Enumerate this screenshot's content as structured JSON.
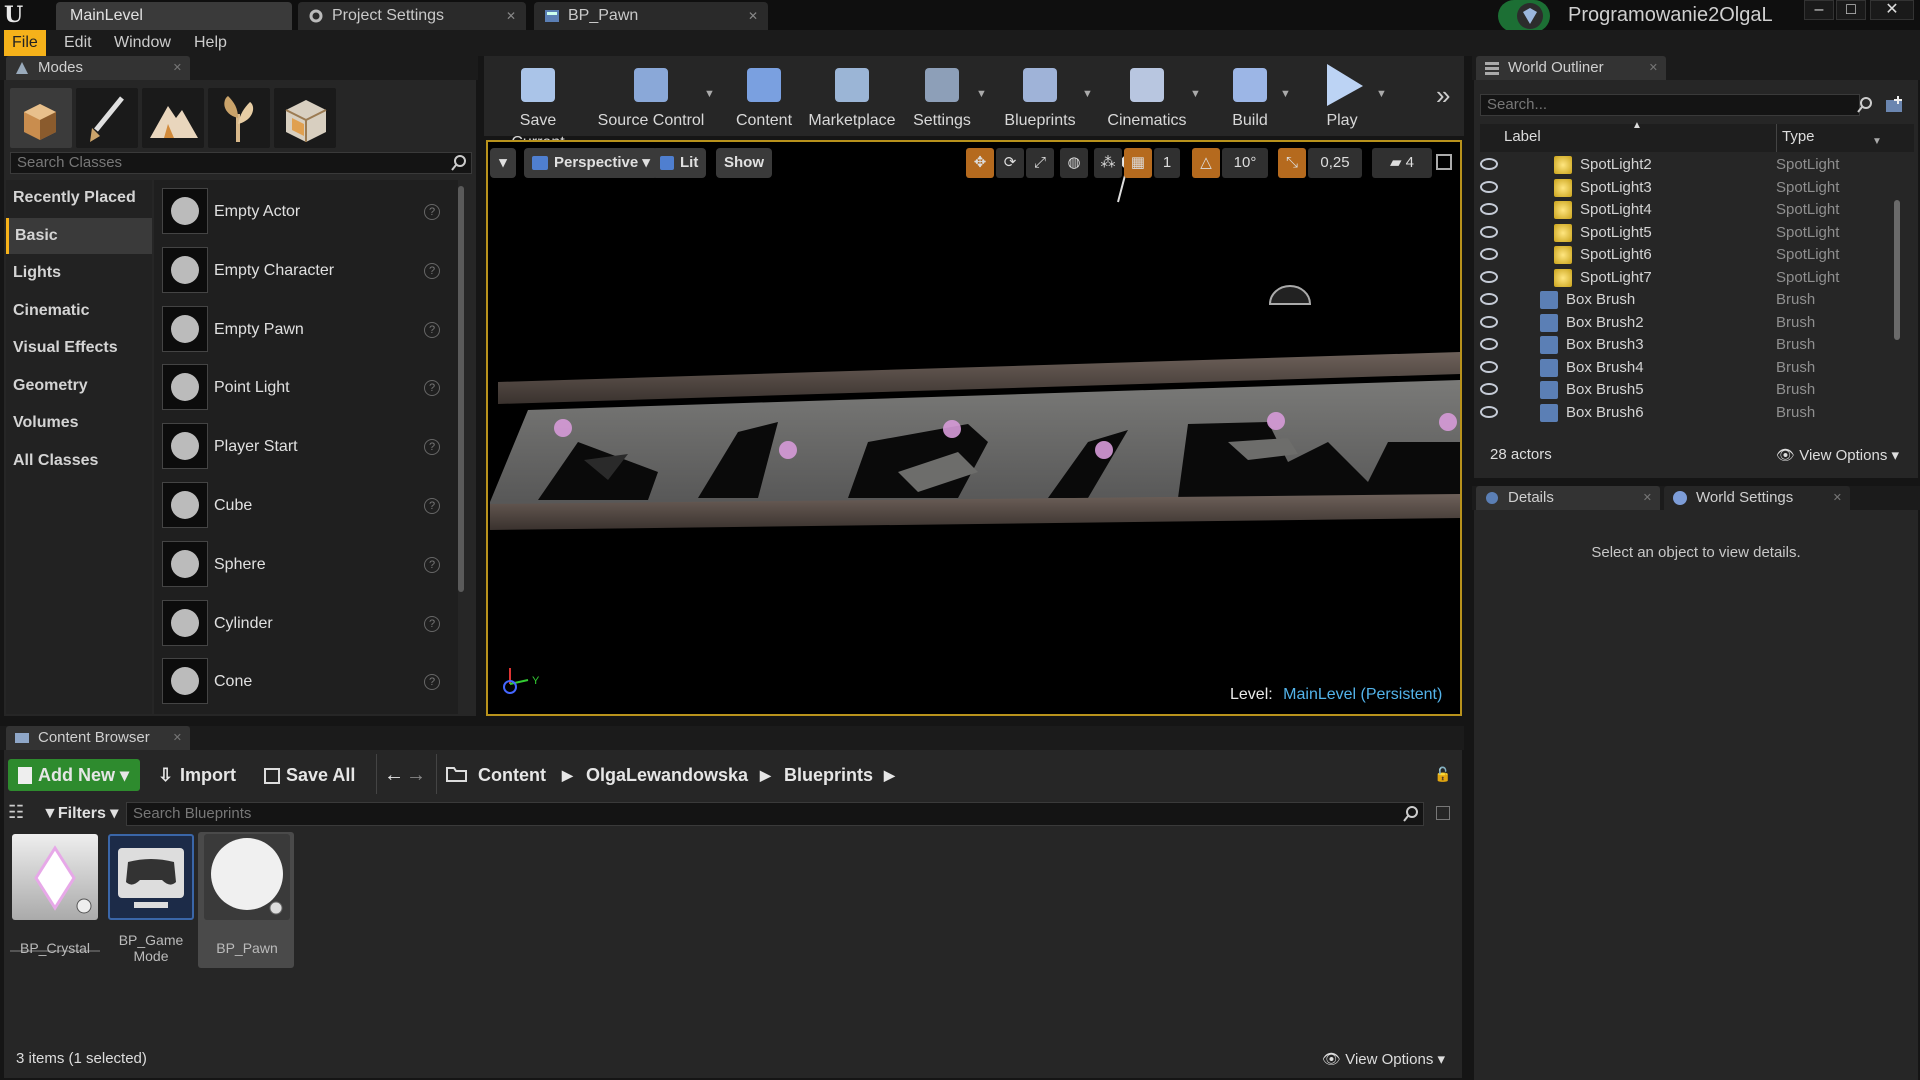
{
  "window": {
    "tabs": [
      {
        "label": "MainLevel",
        "active": true
      },
      {
        "label": "Project Settings",
        "active": false
      },
      {
        "label": "BP_Pawn",
        "active": false
      }
    ],
    "project_name": "Programowanie2OlgaL",
    "controls": {
      "minimize": "‒",
      "maximize": "□",
      "close": "✕"
    }
  },
  "menu": [
    "File",
    "Edit",
    "Window",
    "Help"
  ],
  "modes": {
    "title": "Modes",
    "search_placeholder": "Search Classes",
    "categories": [
      "Recently Placed",
      "Basic",
      "Lights",
      "Cinematic",
      "Visual Effects",
      "Geometry",
      "Volumes",
      "All Classes"
    ],
    "active_category": "Basic",
    "items": [
      "Empty Actor",
      "Empty Character",
      "Empty Pawn",
      "Point Light",
      "Player Start",
      "Cube",
      "Sphere",
      "Cylinder",
      "Cone"
    ],
    "help_glyph": "?"
  },
  "toolbar": {
    "buttons": [
      "Save Current",
      "Source Control",
      "Content",
      "Marketplace",
      "Settings",
      "Blueprints",
      "Cinematics",
      "Build",
      "Play"
    ],
    "overflow": "»"
  },
  "viewport": {
    "perspective": "Perspective",
    "lit": "Lit",
    "show": "Show",
    "grid_snap": "1",
    "rot_snap": "10°",
    "scale_snap": "0,25",
    "camera_speed": "4",
    "level_label": "Level:",
    "level_name": "MainLevel (Persistent)",
    "axis_y": "Y"
  },
  "outliner": {
    "title": "World Outliner",
    "search_placeholder": "Search...",
    "col_label": "Label",
    "col_type": "Type",
    "rows": [
      {
        "label": "SpotLight2",
        "type": "SpotLight",
        "kind": "light"
      },
      {
        "label": "SpotLight3",
        "type": "SpotLight",
        "kind": "light"
      },
      {
        "label": "SpotLight4",
        "type": "SpotLight",
        "kind": "light"
      },
      {
        "label": "SpotLight5",
        "type": "SpotLight",
        "kind": "light"
      },
      {
        "label": "SpotLight6",
        "type": "SpotLight",
        "kind": "light"
      },
      {
        "label": "SpotLight7",
        "type": "SpotLight",
        "kind": "light"
      },
      {
        "label": "Box Brush",
        "type": "Brush",
        "kind": "brush"
      },
      {
        "label": "Box Brush2",
        "type": "Brush",
        "kind": "brush"
      },
      {
        "label": "Box Brush3",
        "type": "Brush",
        "kind": "brush"
      },
      {
        "label": "Box Brush4",
        "type": "Brush",
        "kind": "brush"
      },
      {
        "label": "Box Brush5",
        "type": "Brush",
        "kind": "brush"
      },
      {
        "label": "Box Brush6",
        "type": "Brush",
        "kind": "brush"
      }
    ],
    "count": "28 actors",
    "view_options": "View Options"
  },
  "details": {
    "tab_details": "Details",
    "tab_world_settings": "World Settings",
    "empty_message": "Select an object to view details."
  },
  "content_browser": {
    "title": "Content Browser",
    "add_new": "Add New",
    "import": "Import",
    "save_all": "Save All",
    "path": [
      "Content",
      "OlgaLewandowska",
      "Blueprints"
    ],
    "filters": "Filters",
    "search_placeholder": "Search Blueprints",
    "assets": [
      {
        "name": "BP_Crystal",
        "selected": false
      },
      {
        "name": "BP_Game\nMode",
        "selected": false
      },
      {
        "name": "BP_Pawn",
        "selected": true
      }
    ],
    "status": "3 items (1 selected)",
    "view_options": "View Options"
  },
  "colors": {
    "accent": "#f6b21a",
    "green_button": "#2e8b2e",
    "level_name": "#53b3ea",
    "panel": "#262626"
  }
}
